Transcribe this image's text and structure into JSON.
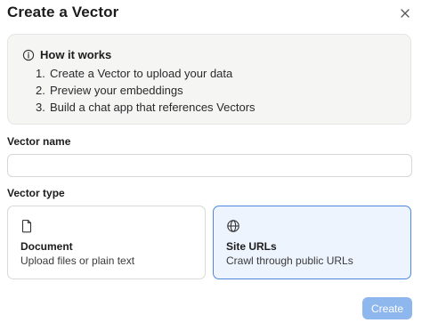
{
  "dialog": {
    "title": "Create a Vector"
  },
  "info": {
    "title": "How it works",
    "steps": [
      {
        "num": "1.",
        "text": "Create a Vector to upload your data"
      },
      {
        "num": "2.",
        "text": "Preview your embeddings"
      },
      {
        "num": "3.",
        "text": "Build a chat app that references Vectors"
      }
    ]
  },
  "vector_name": {
    "label": "Vector name",
    "value": "",
    "placeholder": ""
  },
  "vector_type": {
    "label": "Vector type",
    "selected": "Site URLs",
    "options": [
      {
        "title": "Document",
        "description": "Upload files or plain text",
        "icon": "document-icon"
      },
      {
        "title": "Site URLs",
        "description": "Crawl through public URLs",
        "icon": "globe-icon"
      }
    ]
  },
  "actions": {
    "create_label": "Create"
  },
  "colors": {
    "accent": "#4f86e0",
    "selected_bg": "#eef4fd",
    "disabled_button": "#8eb7ee"
  }
}
